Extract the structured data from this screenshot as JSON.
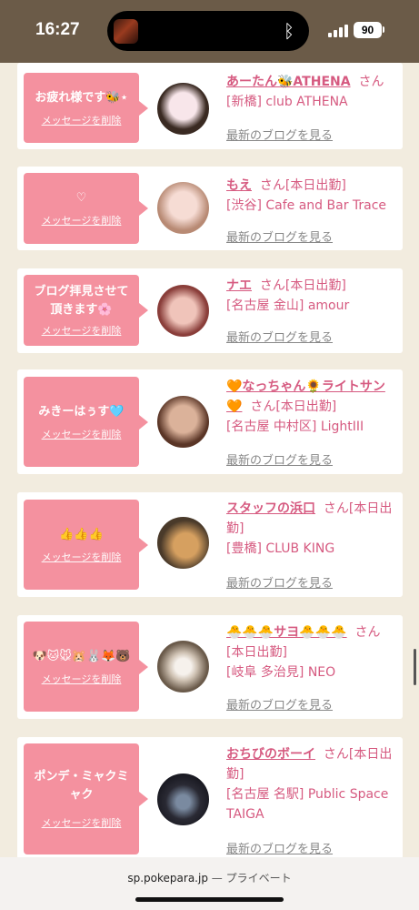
{
  "status": {
    "time": "16:27",
    "battery": "90",
    "bluetooth_icon": "bluetooth-icon"
  },
  "cards": [
    {
      "message": "お疲れ様です🐝⋆",
      "delete": "メッセージを削除",
      "name": "あーたん🐝ATHENA",
      "san": "さん",
      "shop": "[新橋] club ATHENA",
      "blog": "最新のブログを見る",
      "avatar_colors": [
        "#f6d8df",
        "#3a2a22"
      ]
    },
    {
      "message": "♡",
      "delete": "メッセージを削除",
      "name": "もえ",
      "san": "さん[本日出勤]",
      "shop": "[渋谷] Cafe and Bar Trace",
      "blog": "最新のブログを見る",
      "avatar_colors": [
        "#f3d6cf",
        "#b88a74"
      ]
    },
    {
      "message": "ブログ拝見させて頂きます🌸",
      "delete": "メッセージを削除",
      "name": "ナエ",
      "san": "さん[本日出勤]",
      "shop": "[名古屋 金山] amour",
      "blog": "最新のブログを見る",
      "avatar_colors": [
        "#e9b6ad",
        "#8a3e3a"
      ]
    },
    {
      "message": "みきーはぅす🩵",
      "delete": "メッセージを削除",
      "name": "🧡なっちゃん🌻ライトサン🧡",
      "san": "さん[本日出勤]",
      "shop": "[名古屋 中村区] LightIII",
      "blog": "最新のブログを見る",
      "avatar_colors": [
        "#c99d86",
        "#5a3526"
      ]
    },
    {
      "message": "👍👍👍",
      "delete": "メッセージを削除",
      "name": "スタッフの浜口",
      "san": "さん[本日出勤]",
      "shop": "[豊橋] CLUB KING",
      "blog": "最新のブログを見る",
      "avatar_colors": [
        "#4a3a2a",
        "#d6a060"
      ]
    },
    {
      "message": "🐶🐱🐭🐹🐰🦊🐻",
      "delete": "メッセージを削除",
      "name": "🐣🐣🐣サヨ🐣🐣🐣",
      "san": "さん[本日出勤]",
      "shop": "[岐阜 多治見] NEO",
      "blog": "最新のブログを見る",
      "avatar_colors": [
        "#6a5a4a",
        "#cfc2b3"
      ]
    },
    {
      "message": "ポンデ・ミャクミャク",
      "delete": "メッセージを削除",
      "name": "おちびのボーイ",
      "san": "さん[本日出勤]",
      "shop": "[名古屋 名駅] Public Space TAIGA",
      "blog": "最新のブログを見る",
      "avatar_colors": [
        "#1a1a22",
        "#7a8aa0"
      ]
    }
  ],
  "browser": {
    "domain": "sp.pokepara.jp",
    "separator": "—",
    "mode": "プライベート"
  }
}
